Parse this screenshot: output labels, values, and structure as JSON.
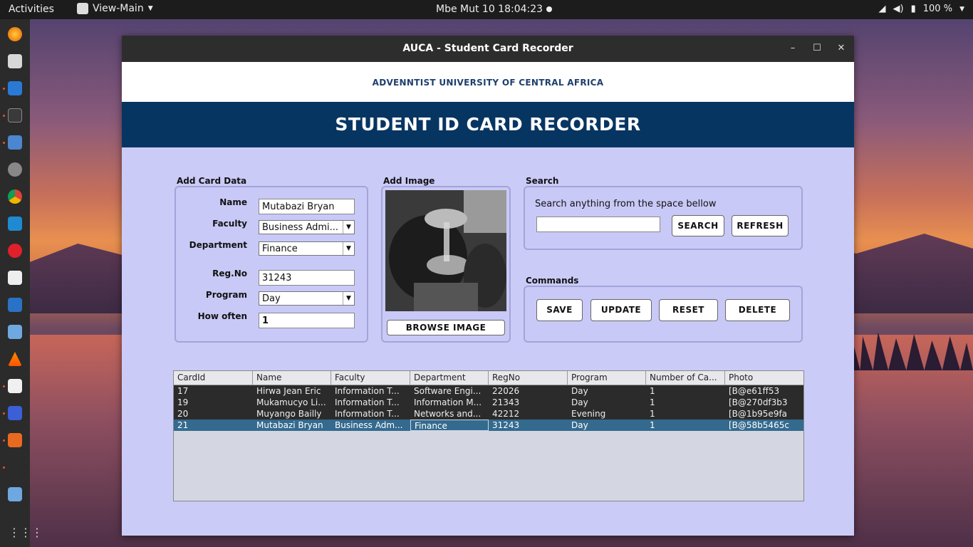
{
  "topbar": {
    "activities": "Activities",
    "app_menu": "View-Main",
    "clock": "Mbe Mut 10  18:04:23",
    "battery": "100 %"
  },
  "dock": {
    "items": [
      "firefox-icon",
      "files-icon",
      "writer-icon",
      "terminal-icon",
      "text-editor-icon",
      "settings-icon",
      "chrome-icon",
      "vscode-icon",
      "opera-icon",
      "downloader-icon",
      "system-monitor-icon",
      "package-icon",
      "vlc-icon",
      "calc-icon",
      "screenshot-icon",
      "impress-icon",
      "package-icon-2"
    ]
  },
  "window": {
    "title": "AUCA - Student Card Recorder",
    "university": "ADVENNTIST UNIVERSITY OF CENTRAL AFRICA",
    "banner": "STUDENT ID CARD RECORDER"
  },
  "card_form": {
    "section_label": "Add Card Data",
    "name_label": "Name",
    "name_value": "Mutabazi Bryan",
    "faculty_label": "Faculty",
    "faculty_value": "Business Admi...",
    "department_label": "Department",
    "department_value": "Finance",
    "regno_label": "Reg.No",
    "regno_value": "31243",
    "program_label": "Program",
    "program_value": "Day",
    "how_often_label": "How often",
    "how_often_value": "1"
  },
  "image_panel": {
    "section_label": "Add Image",
    "browse_label": "BROWSE IMAGE"
  },
  "search_panel": {
    "section_label": "Search",
    "hint": "Search anything from the space bellow",
    "query": "",
    "search_label": "SEARCH",
    "refresh_label": "REFRESH"
  },
  "commands": {
    "section_label": "Commands",
    "save_label": "SAVE",
    "update_label": "UPDATE",
    "reset_label": "RESET",
    "delete_label": "DELETE"
  },
  "table": {
    "columns": [
      "CardId",
      "Name",
      "Faculty",
      "Department",
      "RegNo",
      "Program",
      "Number of Ca...",
      "Photo"
    ],
    "rows": [
      [
        "17",
        "Hirwa Jean Eric",
        "Information T...",
        "Software Engi...",
        "22026",
        "Day",
        "1",
        "[B@e61ff53"
      ],
      [
        "19",
        "Mukamucyo Li...",
        "Information T...",
        "Information M...",
        "21343",
        "Day",
        "1",
        "[B@270df3b3"
      ],
      [
        "20",
        "Muyango Bailly",
        "Information T...",
        "Networks and...",
        "42212",
        "Evening",
        "1",
        "[B@1b95e9fa"
      ],
      [
        "21",
        "Mutabazi Bryan",
        "Business Adm...",
        "Finance",
        "31243",
        "Day",
        "1",
        "[B@58b5465c"
      ]
    ],
    "selected_row": 3
  }
}
